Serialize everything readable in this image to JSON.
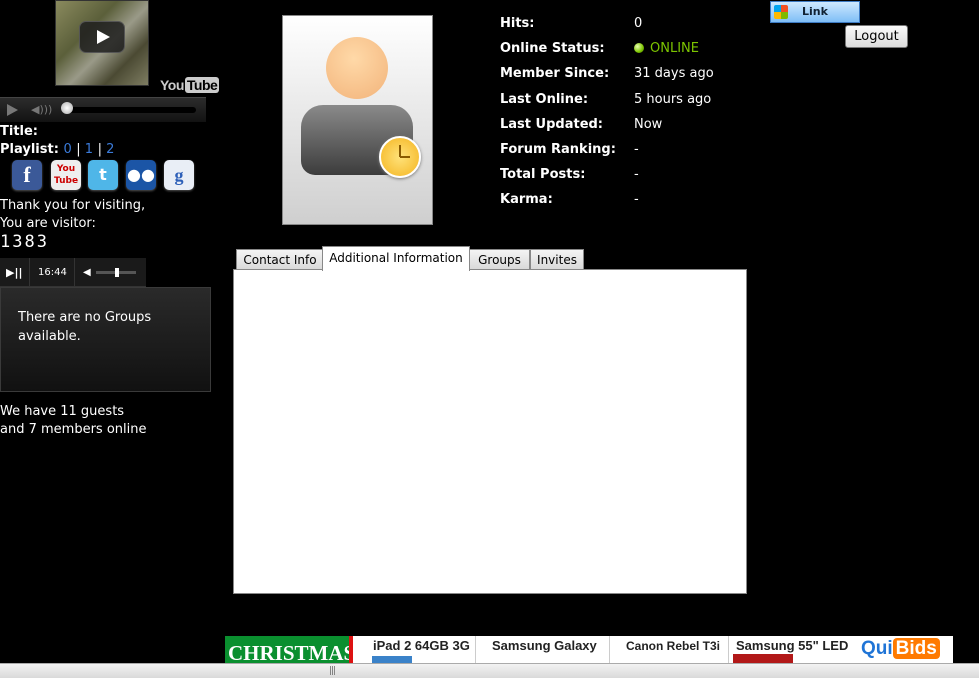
{
  "video": {
    "youtube_logo_you": "You",
    "youtube_logo_tube": "Tube"
  },
  "sidebar": {
    "title_label": "Title:",
    "playlist_label": "Playlist:",
    "playlist_links": [
      "0",
      "1",
      "2"
    ],
    "social_icons": [
      "facebook-icon",
      "youtube-icon",
      "twitter-icon",
      "myspace-icon",
      "google-icon"
    ],
    "visit_line1": "Thank you for visiting,",
    "visit_line2": "You are visitor:",
    "visitor_count": "1383",
    "mini_player": {
      "play_pause": "▶||",
      "time": "16:44"
    },
    "groups_line1": "There are no Groups",
    "groups_line2": "available.",
    "online_line1": "We have 11 guests",
    "online_line2": "and 7 members online"
  },
  "profile": {
    "rows": [
      {
        "label": "Hits:",
        "value": "0"
      },
      {
        "label": "Online Status:",
        "value": "ONLINE"
      },
      {
        "label": "Member Since:",
        "value": "31 days ago"
      },
      {
        "label": "Last Online:",
        "value": "5 hours ago"
      },
      {
        "label": "Last Updated:",
        "value": "Now"
      },
      {
        "label": "Forum Ranking:",
        "value": "-"
      },
      {
        "label": "Total Posts:",
        "value": "-"
      },
      {
        "label": "Karma:",
        "value": "-"
      }
    ],
    "online_color": "#7cc400"
  },
  "header": {
    "link_label": "Link",
    "logout_label": "Logout"
  },
  "tabs": [
    {
      "label": "Contact Info",
      "active": false
    },
    {
      "label": "Additional Information",
      "active": true
    },
    {
      "label": "Groups",
      "active": false
    },
    {
      "label": "Invites",
      "active": false
    }
  ],
  "ads": {
    "christmas": "CHRISTMAS",
    "items": [
      "iPad 2 64GB 3G",
      "Samsung Galaxy",
      "Canon Rebel T3i",
      "Samsung 55\" LED"
    ],
    "quibids_qui": "Qui",
    "quibids_bids": "Bids"
  },
  "scrollbar": {
    "grip": "|||"
  }
}
